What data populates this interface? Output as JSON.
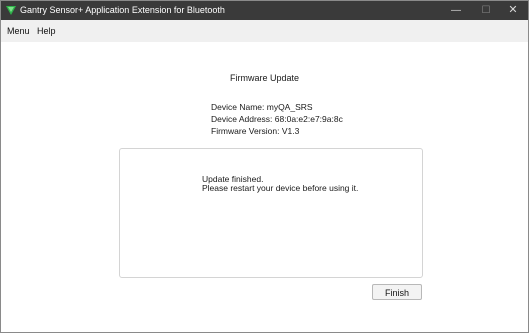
{
  "window": {
    "title": "Gantry Sensor+ Application Extension for Bluetooth",
    "minimize_glyph": "—",
    "maximize_glyph": "☐",
    "close_glyph": "✕",
    "titlebar_color": "#3a3a3a"
  },
  "menu": {
    "items": [
      {
        "label": "Menu"
      },
      {
        "label": "Help"
      }
    ]
  },
  "page": {
    "heading": "Firmware Update",
    "device_name": "Device Name: myQA_SRS",
    "device_address": "Device Address: 68:0a:e2:e7:9a:8c",
    "firmware_version": "Firmware Version: V1.3"
  },
  "message": {
    "line1": "Update finished.",
    "line2": "Please restart your device before using it."
  },
  "actions": {
    "finish_label": "Finish"
  }
}
